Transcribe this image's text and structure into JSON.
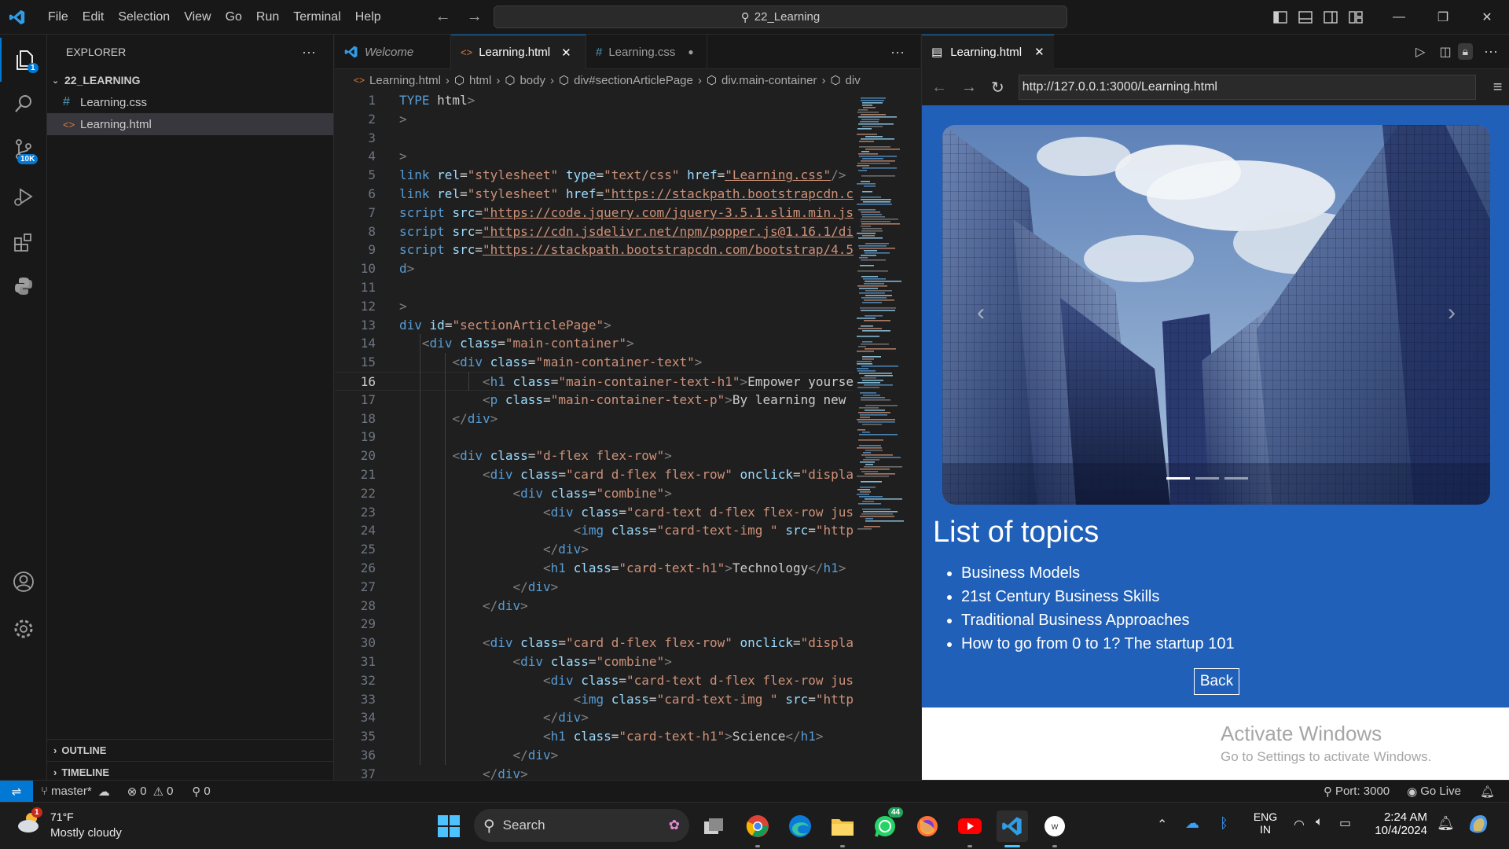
{
  "titlebar": {
    "menu": [
      "File",
      "Edit",
      "Selection",
      "View",
      "Go",
      "Run",
      "Terminal",
      "Help"
    ],
    "search": "22_Learning"
  },
  "activity": {
    "explorer_badge": "1",
    "scm_badge": "10K"
  },
  "sidebar": {
    "title": "EXPLORER",
    "folder": "22_LEARNING",
    "files": [
      {
        "name": "Learning.css",
        "type": "css"
      },
      {
        "name": "Learning.html",
        "type": "html"
      }
    ],
    "outline": "OUTLINE",
    "timeline": "TIMELINE"
  },
  "editor": {
    "tabs": [
      {
        "label": "Welcome",
        "icon": "vscode-icon"
      },
      {
        "label": "Learning.html",
        "icon": "html-icon"
      },
      {
        "label": "Learning.css",
        "icon": "css-icon"
      }
    ],
    "breadcrumbs": [
      "Learning.html",
      "html",
      "body",
      "div#sectionArticlePage",
      "div.main-container",
      "div"
    ],
    "current_line": "16",
    "lines": [
      {
        "n": "1",
        "t": "TYPE html>"
      },
      {
        "n": "2",
        "t": ">"
      },
      {
        "n": "3",
        "t": ""
      },
      {
        "n": "4",
        "t": ">"
      },
      {
        "n": "5",
        "t": "link rel=\"stylesheet\" type=\"text/css\" href=\"Learning.css\"/>"
      },
      {
        "n": "6",
        "t": "link rel=\"stylesheet\" href=\"https://stackpath.bootstrapcdn.c"
      },
      {
        "n": "7",
        "t": "script src=\"https://code.jquery.com/jquery-3.5.1.slim.min.js"
      },
      {
        "n": "8",
        "t": "script src=\"https://cdn.jsdelivr.net/npm/popper.js@1.16.1/di"
      },
      {
        "n": "9",
        "t": "script src=\"https://stackpath.bootstrapcdn.com/bootstrap/4.5"
      },
      {
        "n": "10",
        "t": "d>"
      },
      {
        "n": "11",
        "t": ""
      },
      {
        "n": "12",
        "t": ">"
      },
      {
        "n": "13",
        "t": "div id=\"sectionArticlePage\">"
      },
      {
        "n": "14",
        "t": "   <div class=\"main-container\">"
      },
      {
        "n": "15",
        "t": "       <div class=\"main-container-text\">"
      },
      {
        "n": "16",
        "t": "           <h1 class=\"main-container-text-h1\">Empower yourse"
      },
      {
        "n": "17",
        "t": "           <p class=\"main-container-text-p\">By learning new"
      },
      {
        "n": "18",
        "t": "       </div>"
      },
      {
        "n": "19",
        "t": ""
      },
      {
        "n": "20",
        "t": "       <div class=\"d-flex flex-row\">"
      },
      {
        "n": "21",
        "t": "           <div class=\"card d-flex flex-row\" onclick=\"displa"
      },
      {
        "n": "22",
        "t": "               <div class=\"combine\">"
      },
      {
        "n": "23",
        "t": "                   <div class=\"card-text d-flex flex-row jus"
      },
      {
        "n": "24",
        "t": "                       <img class=\"card-text-img \" src=\"http"
      },
      {
        "n": "25",
        "t": "                   </div>"
      },
      {
        "n": "26",
        "t": "                   <h1 class=\"card-text-h1\">Technology</h1>"
      },
      {
        "n": "27",
        "t": "               </div>"
      },
      {
        "n": "28",
        "t": "           </div>"
      },
      {
        "n": "29",
        "t": ""
      },
      {
        "n": "30",
        "t": "           <div class=\"card d-flex flex-row\" onclick=\"displa"
      },
      {
        "n": "31",
        "t": "               <div class=\"combine\">"
      },
      {
        "n": "32",
        "t": "                   <div class=\"card-text d-flex flex-row jus"
      },
      {
        "n": "33",
        "t": "                       <img class=\"card-text-img \" src=\"http"
      },
      {
        "n": "34",
        "t": "                   </div>"
      },
      {
        "n": "35",
        "t": "                   <h1 class=\"card-text-h1\">Science</h1>"
      },
      {
        "n": "36",
        "t": "               </div>"
      },
      {
        "n": "37",
        "t": "           </div>"
      }
    ]
  },
  "browser": {
    "tab_label": "Learning.html",
    "url": "http://127.0.0.1:3000/Learning.html",
    "page": {
      "heading": "List of topics",
      "topics": [
        "Business Models",
        "21st Century Business Skills",
        "Traditional Business Approaches",
        "How to go from 0 to 1? The startup 101"
      ],
      "back_label": "Back",
      "carousel_slides": 3,
      "carousel_active": 1
    },
    "watermark_title": "Activate Windows",
    "watermark_sub": "Go to Settings to activate Windows."
  },
  "statusbar": {
    "branch": "master*",
    "errors": "0",
    "warnings": "0",
    "ports": "0",
    "port_label": "Port: 3000",
    "golive": "Go Live"
  },
  "taskbar": {
    "weather_temp": "71°F",
    "weather_desc": "Mostly cloudy",
    "weather_badge": "1",
    "search": "Search",
    "whatsapp_badge": "44",
    "lang1": "ENG",
    "lang2": "IN",
    "time": "2:24 AM",
    "date": "10/4/2024"
  },
  "colors": {
    "accent": "#0078d4",
    "page_blue": "#2160b8",
    "tag": "#569cd6",
    "attr": "#9cdcfe",
    "string": "#ce9178"
  }
}
